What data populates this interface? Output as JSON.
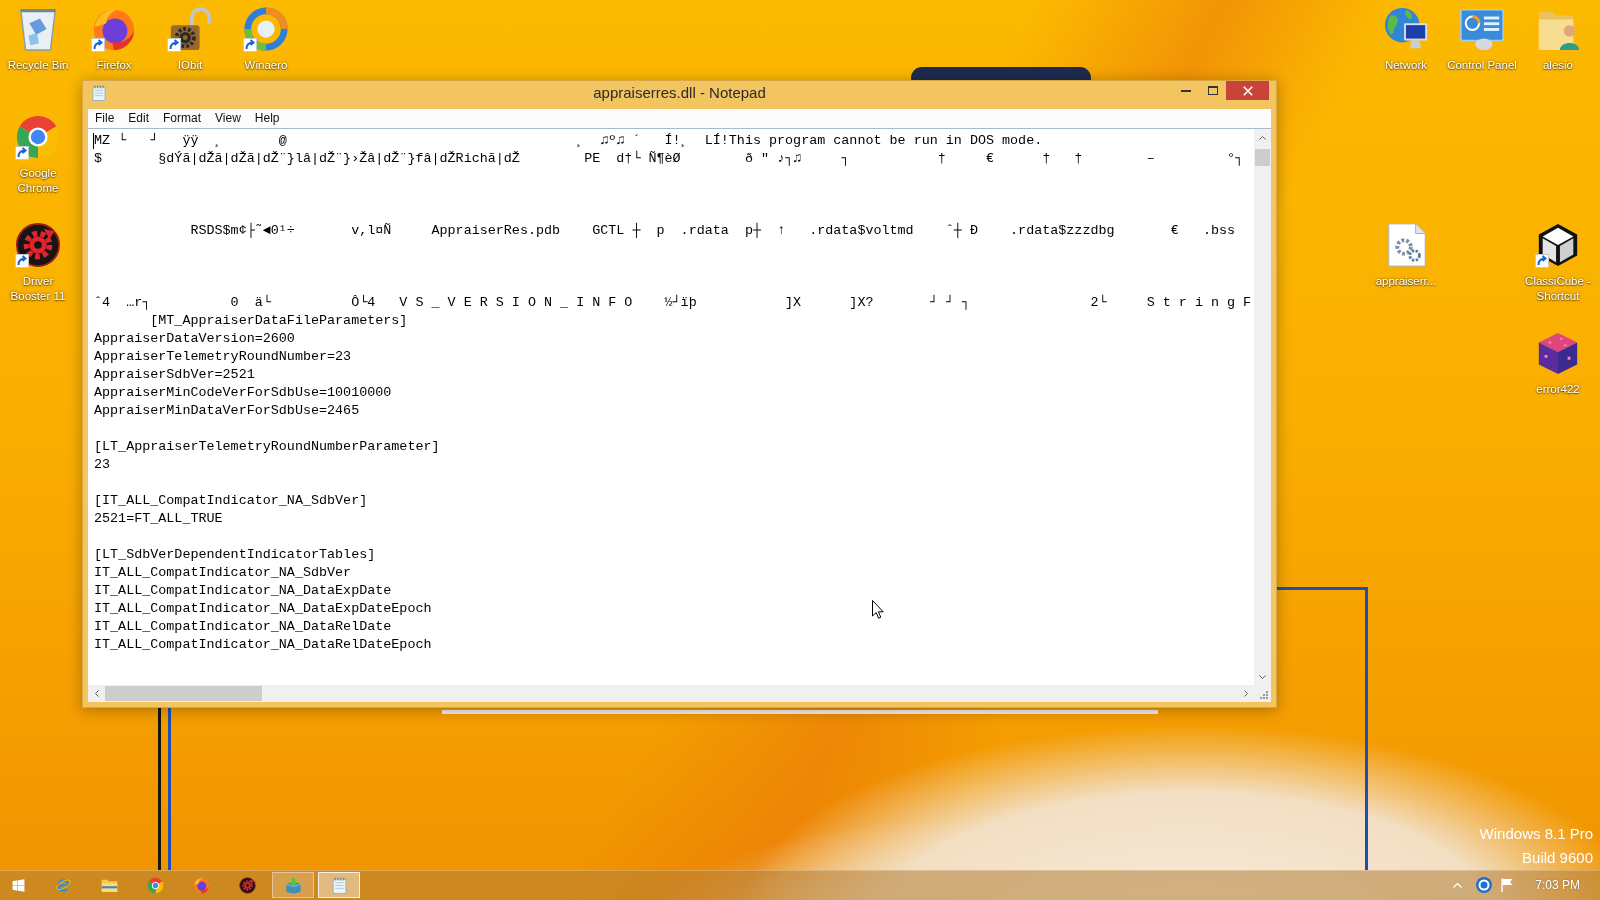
{
  "desktop": {
    "icons": [
      {
        "label": "Recycle Bin",
        "kind": "recyclebin",
        "shortcut": false
      },
      {
        "label": "Firefox",
        "kind": "firefox",
        "shortcut": true
      },
      {
        "label": "IObit",
        "kind": "padlock",
        "shortcut": true
      },
      {
        "label": "Winaero",
        "kind": "swirl",
        "shortcut": true
      },
      {
        "label": "Network",
        "kind": "network",
        "shortcut": false
      },
      {
        "label": "Control Panel",
        "kind": "controlpanel",
        "shortcut": false
      },
      {
        "label": "alesio",
        "kind": "userfolder",
        "shortcut": false
      },
      {
        "label": "Google Chrome",
        "kind": "chrome",
        "shortcut": true
      },
      {
        "label": "Driver Booster 11",
        "kind": "booster",
        "shortcut": true
      },
      {
        "label": "appraiserr...",
        "kind": "dllfile",
        "shortcut": false
      },
      {
        "label": "ClassiCube - Shortcut",
        "kind": "cube",
        "shortcut": true
      },
      {
        "label": "error422",
        "kind": "pixelcube",
        "shortcut": false
      }
    ],
    "os_edition": "Windows 8.1 Pro",
    "os_build": "Build 9600"
  },
  "notepad": {
    "title": "appraiserres.dll - Notepad",
    "menu": [
      "File",
      "Edit",
      "Format",
      "View",
      "Help"
    ],
    "text": "MZ └   ┘   ÿÿ  ¸       @                                    ¸  ♫º♫ ´   Í!¸  LÍ!This program cannot be run in DOS mode.\n$       §dÝã|dŽã|dŽã|dŽ¨}lâ|dŽ¨}›Žâ|dŽ¨}fâ|dŽRichã|dŽ        PE  d†└ Ñ¶èØ        ð \" ♪┐♫     ┐           †     €      †   †        –         °┐\n\n\n\n            RSDS$m¢├˜◄0¹÷       v,l¤Ñ     AppraiserRes.pdb    GCTL ┼  p  .rdata  p┼  ↑   .rdata$voltmd    ˆ┼ Ð    .rdata$zzzdbg       €   .bss\n\n\n\nˆ4  …r┐          0  ä└          Ô└4   V S _ V E R S I O N _ I N F O    ½┘ïþ           ]X      ]X?       ┘ ┘ ┐               2└     S t r i n g F\n       [MT_AppraiserDataFileParameters]\nAppraiserDataVersion=2600\nAppraiserTelemetryRoundNumber=23\nAppraiserSdbVer=2521\nAppraiserMinCodeVerForSdbUse=10010000\nAppraiserMinDataVerForSdbUse=2465\n\n[LT_AppraiserTelemetryRoundNumberParameter]\n23\n\n[IT_ALL_CompatIndicator_NA_SdbVer]\n2521=FT_ALL_TRUE\n\n[LT_SdbVerDependentIndicatorTables]\nIT_ALL_CompatIndicator_NA_SdbVer\nIT_ALL_CompatIndicator_NA_DataExpDate\nIT_ALL_CompatIndicator_NA_DataExpDateEpoch\nIT_ALL_CompatIndicator_NA_DataRelDate\nIT_ALL_CompatIndicator_NA_DataRelDateEpoch"
  },
  "taskbar": {
    "items": [
      {
        "kind": "start",
        "running": false,
        "selected": false
      },
      {
        "kind": "ie",
        "running": false,
        "selected": false
      },
      {
        "kind": "explorer",
        "running": false,
        "selected": false
      },
      {
        "kind": "chrome",
        "running": false,
        "selected": false
      },
      {
        "kind": "firefox",
        "running": false,
        "selected": false
      },
      {
        "kind": "booster",
        "running": false,
        "selected": false
      },
      {
        "kind": "app",
        "running": true,
        "selected": false
      },
      {
        "kind": "notepad",
        "running": true,
        "selected": true
      }
    ],
    "clock": "7:03 PM"
  }
}
